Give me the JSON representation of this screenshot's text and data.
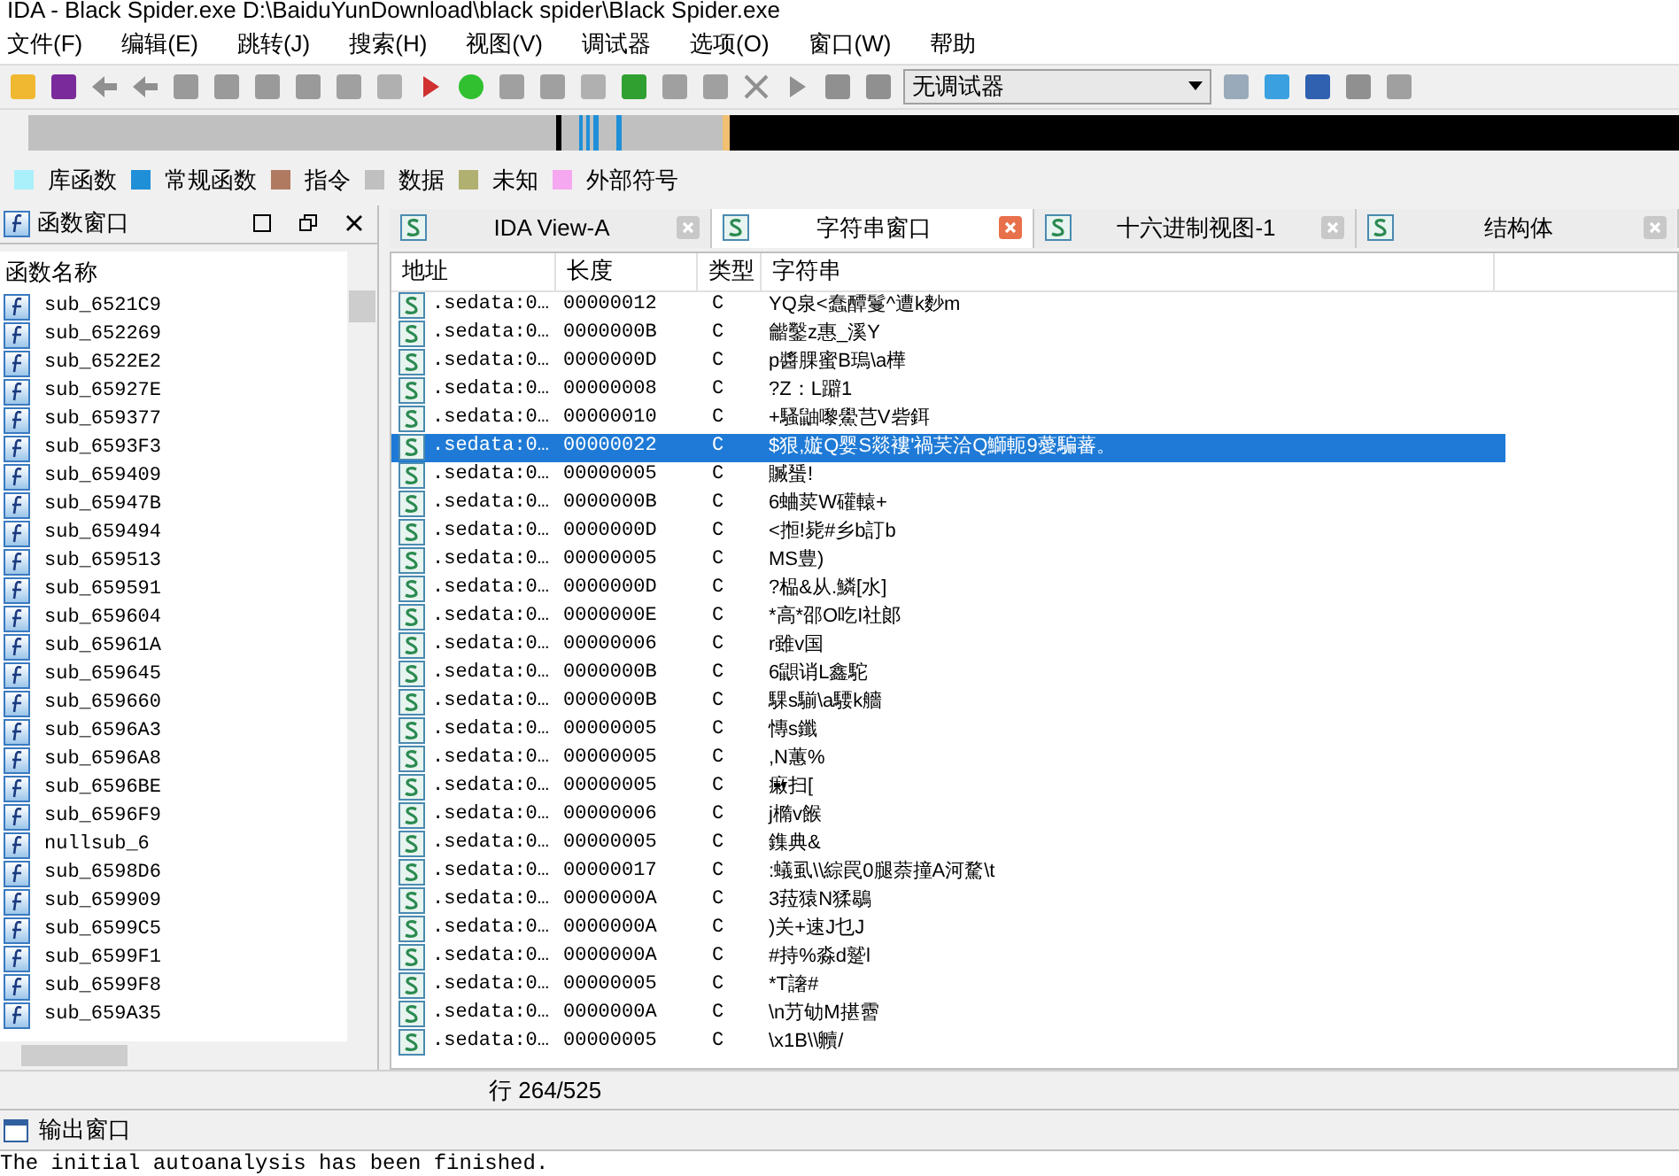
{
  "window": {
    "title": "IDA - Black Spider.exe D:\\BaiduYunDownload\\black spider\\Black Spider.exe"
  },
  "menu": [
    "文件(F)",
    "编辑(E)",
    "跳转(J)",
    "搜索(H)",
    "视图(V)",
    "调试器",
    "选项(O)",
    "窗口(W)",
    "帮助"
  ],
  "toolbar": {
    "debugger": "无调试器"
  },
  "legend": [
    {
      "label": "库函数",
      "color": "#aaf0fa"
    },
    {
      "label": "常规函数",
      "color": "#1f8fd8"
    },
    {
      "label": "指令",
      "color": "#b07a60"
    },
    {
      "label": "数据",
      "color": "#c0c0c0"
    },
    {
      "label": "未知",
      "color": "#b0b070"
    },
    {
      "label": "外部符号",
      "color": "#f5a8f0"
    }
  ],
  "functions_panel": {
    "title": "函数窗口",
    "column": "函数名称",
    "items": [
      "sub_6521C9",
      "sub_652269",
      "sub_6522E2",
      "sub_65927E",
      "sub_659377",
      "sub_6593F3",
      "sub_659409",
      "sub_65947B",
      "sub_659494",
      "sub_659513",
      "sub_659591",
      "sub_659604",
      "sub_65961A",
      "sub_659645",
      "sub_659660",
      "sub_6596A3",
      "sub_6596A8",
      "sub_6596BE",
      "sub_6596F9",
      "nullsub_6",
      "sub_6598D6",
      "sub_659909",
      "sub_6599C5",
      "sub_6599F1",
      "sub_6599F8",
      "sub_659A35"
    ]
  },
  "tabs": [
    {
      "label": "IDA View-A",
      "selected": false
    },
    {
      "label": "字符串窗口",
      "selected": true
    },
    {
      "label": "十六进制视图-1",
      "selected": false
    },
    {
      "label": "结构体",
      "selected": false
    }
  ],
  "strings_table": {
    "columns": [
      "地址",
      "长度",
      "类型",
      "字符串"
    ],
    "rows": [
      {
        "address": ".sedata:0…",
        "length": "00000012",
        "type": "C",
        "string": "YQ泉<蠢醰鬘^遭k麨m",
        "selected": false
      },
      {
        "address": ".sedata:0…",
        "length": "0000000B",
        "type": "C",
        "string": "龤鑿z惠_溪Y",
        "selected": false
      },
      {
        "address": ".sedata:0…",
        "length": "0000000D",
        "type": "C",
        "string": "p醬腂蜜B瑦\\a樺",
        "selected": false
      },
      {
        "address": ".sedata:0…",
        "length": "00000008",
        "type": "C",
        "string": "?Z：L躃1",
        "selected": false
      },
      {
        "address": ".sedata:0…",
        "length": "00000010",
        "type": "C",
        "string": "+騷鼬嚟鱟芑V砦鉺",
        "selected": false
      },
      {
        "address": ".sedata:0…",
        "length": "00000022",
        "type": "C",
        "string": "$狠,嫙Q婴S燚褸'禍芺洽Q鰤軛9薆騙蕃。",
        "selected": true
      },
      {
        "address": ".sedata:0…",
        "length": "00000005",
        "type": "C",
        "string": "贓蜑!",
        "selected": false
      },
      {
        "address": ".sedata:0…",
        "length": "0000000B",
        "type": "C",
        "string": "6蛐荬W礶轅+",
        "selected": false
      },
      {
        "address": ".sedata:0…",
        "length": "0000000D",
        "type": "C",
        "string": "<搄!毙#乡b訂b",
        "selected": false
      },
      {
        "address": ".sedata:0…",
        "length": "00000005",
        "type": "C",
        "string": "MS豊)",
        "selected": false
      },
      {
        "address": ".sedata:0…",
        "length": "0000000D",
        "type": "C",
        "string": "?榀&从.鱗[水]",
        "selected": false
      },
      {
        "address": ".sedata:0…",
        "length": "0000000E",
        "type": "C",
        "string": "*高*邵O吃I社郞",
        "selected": false
      },
      {
        "address": ".sedata:0…",
        "length": "00000006",
        "type": "C",
        "string": "r雖v国",
        "selected": false
      },
      {
        "address": ".sedata:0…",
        "length": "0000000B",
        "type": "C",
        "string": "6鼰诮L鑫駝",
        "selected": false
      },
      {
        "address": ".sedata:0…",
        "length": "0000000B",
        "type": "C",
        "string": "騍s騚\\a騕k艢",
        "selected": false
      },
      {
        "address": ".sedata:0…",
        "length": "00000005",
        "type": "C",
        "string": "慱s鑯",
        "selected": false
      },
      {
        "address": ".sedata:0…",
        "length": "00000005",
        "type": "C",
        "string": ",N蕙%",
        "selected": false
      },
      {
        "address": ".sedata:0…",
        "length": "00000005",
        "type": "C",
        "string": "瘷扫[",
        "selected": false
      },
      {
        "address": ".sedata:0…",
        "length": "00000006",
        "type": "C",
        "string": "j橢v餱",
        "selected": false
      },
      {
        "address": ".sedata:0…",
        "length": "00000005",
        "type": "C",
        "string": "鏶典&",
        "selected": false
      },
      {
        "address": ".sedata:0…",
        "length": "00000017",
        "type": "C",
        "string": ":蟻虱\\\\綜罠0腿萘撞A河騖\\t",
        "selected": false
      },
      {
        "address": ".sedata:0…",
        "length": "0000000A",
        "type": "C",
        "string": "3菈猿N猱鶡",
        "selected": false
      },
      {
        "address": ".sedata:0…",
        "length": "0000000A",
        "type": "C",
        "string": ")关+速J乜J",
        "selected": false
      },
      {
        "address": ".sedata:0…",
        "length": "0000000A",
        "type": "C",
        "string": "#持%淼d蹵l",
        "selected": false
      },
      {
        "address": ".sedata:0…",
        "length": "00000005",
        "type": "C",
        "string": "*T譇#",
        "selected": false
      },
      {
        "address": ".sedata:0…",
        "length": "0000000A",
        "type": "C",
        "string": "\\n芀劬M揕霫",
        "selected": false
      },
      {
        "address": ".sedata:0…",
        "length": "00000005",
        "type": "C",
        "string": "\\x1B\\\\贕/",
        "selected": false
      }
    ]
  },
  "status_bar": "行 264/525",
  "output_panel": {
    "title": "输出窗口",
    "text": "The initial autoanalysis has been finished."
  }
}
